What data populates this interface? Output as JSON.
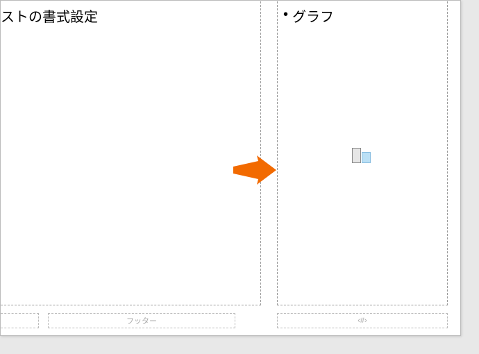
{
  "leftPlaceholder": {
    "text": "ストの書式設定"
  },
  "rightPlaceholder": {
    "bulletText": "グラフ"
  },
  "footer": {
    "centerLabel": "フッター",
    "pageNumLabel": "‹#›"
  },
  "icons": {
    "chart": "chart-icon",
    "arrow": "arrow-right-icon"
  },
  "colors": {
    "arrow": "#f26a00"
  }
}
